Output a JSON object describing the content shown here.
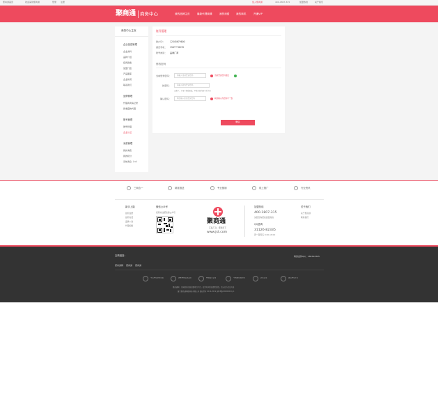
{
  "topbar": {
    "left": [
      "聚商通首页",
      "欢迎来到聚商通",
      "登录",
      "注册"
    ],
    "right": [
      "加入聚商通",
      "400-1807-315",
      "加盟热线",
      "关于我们"
    ]
  },
  "header": {
    "logo_text": "聚商通",
    "logo_sub": "商务中心",
    "nav": [
      "我的品牌主页",
      "最新代理商情",
      "我的消费",
      "我的商机",
      "开通VIP"
    ]
  },
  "sidebar": {
    "title": "商务中心主页",
    "groups": [
      {
        "title": "企业信息管理",
        "items": [
          "企业资料",
          "品牌介绍",
          "招商政策",
          "加盟门店",
          "产品图库",
          "企业新闻",
          "联系我们"
        ]
      },
      {
        "title": "品牌管理",
        "items": [
          "代理商商情记录",
          "我收藏的代理"
        ]
      },
      {
        "title": "账号管理",
        "items": [
          "账号管理",
          "企业认证"
        ]
      },
      {
        "title": "消费管理",
        "items": [
          "我的消费",
          "我的积分",
          "系统消息（12）"
        ]
      }
    ],
    "active_item": "企业认证"
  },
  "main": {
    "section1_title": "账号管理",
    "fields": [
      {
        "label": "账户ID：",
        "value": "12345679800"
      },
      {
        "label": "绑定手机：",
        "value": "158****8076"
      },
      {
        "label": "账号类别：",
        "value": "品牌厂商"
      }
    ],
    "section2_title": "修改密码",
    "pwd_rows": [
      {
        "label": "当前登录密码：",
        "placeholder": "请输入当前登录密码",
        "msg": "当前登录密码错误",
        "msg_type": "error"
      },
      {
        "label": "新密码：",
        "placeholder": "请输入新的登录密码",
        "msg": "",
        "msg_type": "none"
      },
      {
        "label": "确认密码：",
        "placeholder": "再次输入新的登录密码",
        "msg": "两次输入的密码不一致",
        "msg_type": "error"
      }
    ],
    "pwd_hint": "以数字、字母下划线组成，不能全部为数字或字母",
    "submit_label": "确认"
  },
  "features": [
    "三网合一",
    "精准推送",
    "专业营销",
    "线上推广",
    "行业资讯"
  ],
  "footer": {
    "col1_title": "新手上路",
    "col1_links": [
      "如何注册",
      "如何付费",
      "品牌入驻",
      "代理加盟"
    ],
    "col2_title": "微信公众号",
    "col2_sub": "扫码关注聚商通公众号",
    "logo_text": "聚商通",
    "logo_slogan": "汇集厂商 · 聚通天下",
    "logo_url": "www.jst.com",
    "hotline_title": "加盟热线",
    "hotline": "400-1807-315",
    "hotline_sub": "免费咨询招商加盟热线",
    "qq_title": "QQ咨询",
    "qq": "31126-82335",
    "qq_sub": "周一至周五 9:00-18:00",
    "col5_title": "关于我们",
    "col5_links": [
      "关于聚商通",
      "联系我们"
    ]
  },
  "dark_footer": {
    "links_label": "友情链接：",
    "links": [
      "聚商通网",
      "聚商通",
      "聚商通"
    ],
    "right_text": "商务合作QQ：158312345",
    "badges": [
      "可信网站身份验证",
      "国家网络信息安全",
      "网络安全认证",
      "中国域名服务商",
      "实名认证",
      "诚信网站示范"
    ],
    "copyright_1": "聚商通网 · 全国知名招商加盟项目平台，投资有风险加盟需谨慎，请以官方信息为准",
    "copyright_2": "厦门聚商通网络科技有限公司 版权所有 2014-2019  闽ICP备00000000号-1"
  },
  "colors": {
    "accent": "#ee4a5e",
    "dark_footer": "#333333",
    "success": "#3fb24f"
  }
}
